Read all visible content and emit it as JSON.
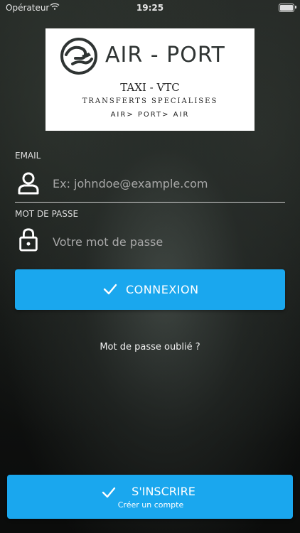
{
  "status_bar": {
    "carrier": "Opérateur",
    "time": "19:25"
  },
  "logo": {
    "name": "AIR - PORT",
    "tagline1": "TAXI - VTC",
    "tagline2": "TRANSFERTS SPECIALISES",
    "tagline3": "AIR> PORT> AIR"
  },
  "email": {
    "label": "EMAIL",
    "placeholder": "Ex: johndoe@example.com",
    "icon": "user-icon"
  },
  "password": {
    "label": "MOT DE PASSE",
    "placeholder": "Votre mot de passe",
    "icon": "lock-icon"
  },
  "login_button": {
    "label": "CONNEXION",
    "icon": "check-icon"
  },
  "forgot_link": "Mot de passe oublié ?",
  "register_button": {
    "label": "S'INSCRIRE",
    "sublabel": "Créer un compte",
    "icon": "check-icon"
  },
  "colors": {
    "accent": "#1aa7ee",
    "text": "#ffffff",
    "logo_bg": "#ffffff"
  }
}
